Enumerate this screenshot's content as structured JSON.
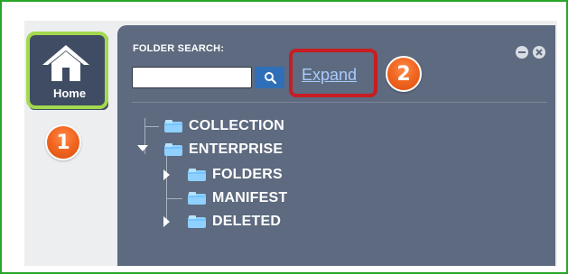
{
  "panel": {
    "folder_search_label": "FOLDER SEARCH:",
    "search_input_value": "",
    "search_placeholder": "",
    "expand_link_label": "Expand"
  },
  "home": {
    "label": "Home"
  },
  "tree": {
    "items": [
      {
        "label": "COLLECTION",
        "state": "leaf"
      },
      {
        "label": "ENTERPRISE",
        "state": "expanded"
      },
      {
        "label": "FOLDERS",
        "state": "collapsed"
      },
      {
        "label": "MANIFEST",
        "state": "leaf"
      },
      {
        "label": "DELETED",
        "state": "collapsed"
      }
    ]
  },
  "badges": [
    {
      "label": "1"
    },
    {
      "label": "2"
    }
  ],
  "colors": {
    "outer_frame": "#2aa52a",
    "panel_bg": "#5d6a7f",
    "home_highlight": "#a3d94e",
    "expand_highlight": "#c71d22",
    "search_button": "#2f6fb8",
    "link": "#a8cbff"
  },
  "icons": {
    "home": "home-icon",
    "search": "search-icon",
    "panel_minimize": "minimize-icon",
    "panel_close": "close-icon",
    "folder": "folder-icon",
    "tree_expander_expanded": "tree-expanded-icon",
    "tree_expander_collapsed": "tree-collapsed-icon"
  }
}
